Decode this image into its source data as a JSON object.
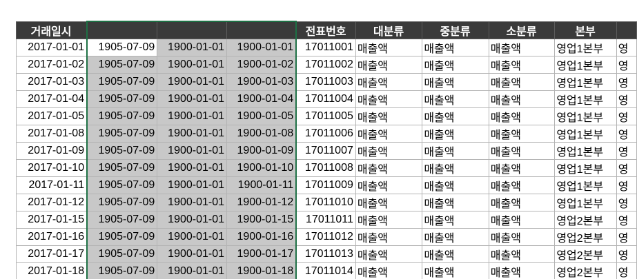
{
  "sheet": {
    "headers": [
      "거래일시",
      "",
      "",
      "",
      "전표번호",
      "대분류",
      "중분류",
      "소분류",
      "본부",
      ""
    ],
    "rows": [
      [
        "2017-01-01",
        "1905-07-09",
        "1900-01-01",
        "1900-01-01",
        "17011001",
        "매출액",
        "매출액",
        "매출액",
        "영업1본부",
        "영"
      ],
      [
        "2017-01-02",
        "1905-07-09",
        "1900-01-01",
        "1900-01-02",
        "17011002",
        "매출액",
        "매출액",
        "매출액",
        "영업1본부",
        "영"
      ],
      [
        "2017-01-03",
        "1905-07-09",
        "1900-01-01",
        "1900-01-03",
        "17011003",
        "매출액",
        "매출액",
        "매출액",
        "영업1본부",
        "영"
      ],
      [
        "2017-01-04",
        "1905-07-09",
        "1900-01-01",
        "1900-01-04",
        "17011004",
        "매출액",
        "매출액",
        "매출액",
        "영업1본부",
        "영"
      ],
      [
        "2017-01-05",
        "1905-07-09",
        "1900-01-01",
        "1900-01-05",
        "17011005",
        "매출액",
        "매출액",
        "매출액",
        "영업1본부",
        "영"
      ],
      [
        "2017-01-08",
        "1905-07-09",
        "1900-01-01",
        "1900-01-08",
        "17011006",
        "매출액",
        "매출액",
        "매출액",
        "영업1본부",
        "영"
      ],
      [
        "2017-01-09",
        "1905-07-09",
        "1900-01-01",
        "1900-01-09",
        "17011007",
        "매출액",
        "매출액",
        "매출액",
        "영업1본부",
        "영"
      ],
      [
        "2017-01-10",
        "1905-07-09",
        "1900-01-01",
        "1900-01-10",
        "17011008",
        "매출액",
        "매출액",
        "매출액",
        "영업1본부",
        "영"
      ],
      [
        "2017-01-11",
        "1905-07-09",
        "1900-01-01",
        "1900-01-11",
        "17011009",
        "매출액",
        "매출액",
        "매출액",
        "영업1본부",
        "영"
      ],
      [
        "2017-01-12",
        "1905-07-09",
        "1900-01-01",
        "1900-01-12",
        "17011010",
        "매출액",
        "매출액",
        "매출액",
        "영업1본부",
        "영"
      ],
      [
        "2017-01-15",
        "1905-07-09",
        "1900-01-01",
        "1900-01-15",
        "17011011",
        "매출액",
        "매출액",
        "매출액",
        "영업2본부",
        "영"
      ],
      [
        "2017-01-16",
        "1905-07-09",
        "1900-01-01",
        "1900-01-16",
        "17011012",
        "매출액",
        "매출액",
        "매출액",
        "영업2본부",
        "영"
      ],
      [
        "2017-01-17",
        "1905-07-09",
        "1900-01-01",
        "1900-01-17",
        "17011013",
        "매출액",
        "매출액",
        "매출액",
        "영업2본부",
        "영"
      ],
      [
        "2017-01-18",
        "1905-07-09",
        "1900-01-01",
        "1900-01-18",
        "17011014",
        "매출액",
        "매출액",
        "매출액",
        "영업2본부",
        "영"
      ]
    ],
    "colors": {
      "header_bg": "#3a3a3a",
      "header_text": "#ffffff",
      "selection_fill": "#c8c8c8",
      "selection_border": "#1e7145",
      "gridline": "#b4b4b4"
    }
  }
}
